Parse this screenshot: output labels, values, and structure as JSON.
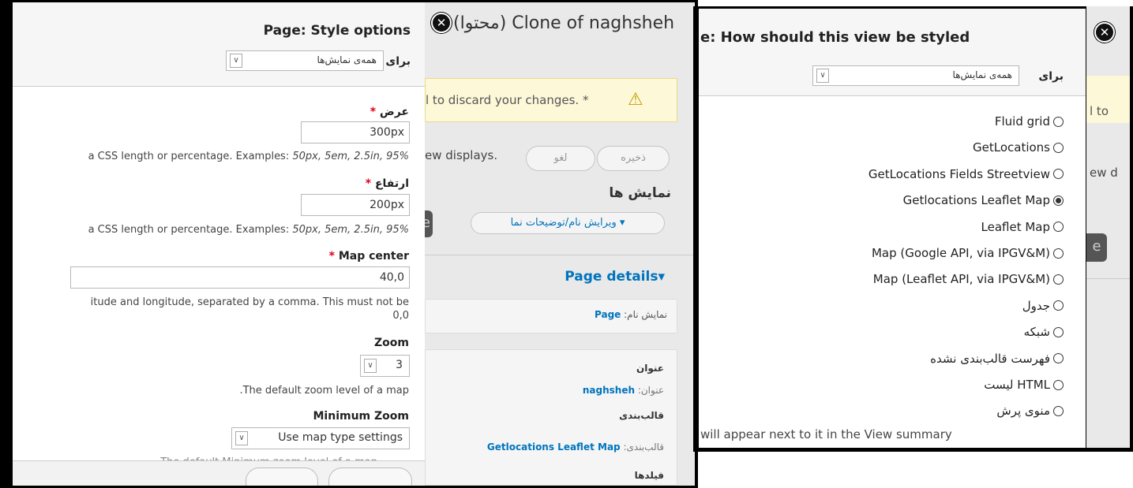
{
  "left_dialog": {
    "title": "Page: Style options",
    "for_label": "برای",
    "for_value": "همه‌ی نمایش‌ها",
    "width": {
      "label": "عرض",
      "value": "300px",
      "desc_prefix": "a CSS length or percentage. Examples: ",
      "desc_examples": "50px, 5em, 2.5in, 95%"
    },
    "height": {
      "label": "ارتفاع",
      "value": "200px",
      "desc_prefix": "a CSS length or percentage. Examples: ",
      "desc_examples": "50px, 5em, 2.5in, 95%"
    },
    "map_center": {
      "label": "Map center",
      "value": "40,0",
      "desc_line1": "itude and longitude, separated by a comma. This must not be",
      "desc_line2": "0,0"
    },
    "zoom": {
      "label": "Zoom",
      "value": "3",
      "desc": ".The default zoom level of a map"
    },
    "min_zoom": {
      "label": "Minimum Zoom",
      "value": "Use map type settings",
      "desc_partial": "The default Minimum zoom level of a map"
    },
    "required_mark": "*"
  },
  "left_background": {
    "header_title": "(محتوا) Clone of naghsheh",
    "warning_text": "l to discard your changes. *",
    "displays_text": "ew displays.",
    "save_button": "ذخیره",
    "cancel_button": "لغو",
    "displays_heading": "نمایش ها",
    "edit_name_label": "ویرایش نام/توضیحات نما",
    "page_details": "Page details",
    "display_name_label": "نمایش نام:",
    "display_name_value": "Page",
    "title_heading": "عنوان",
    "title_label": "عنوان:",
    "title_value": "naghsheh",
    "format_heading": "قالب‌بندی",
    "format_label": "قالب‌بندی:",
    "format_value": "Getlocations Leaflet Map",
    "fields_heading": "فیلدها",
    "side_button": "e"
  },
  "right_dialog": {
    "title": "e: How should this view be styled",
    "for_label": "برای",
    "for_value": "همه‌ی نمایش‌ها",
    "options": [
      {
        "label": "Fluid grid",
        "checked": false
      },
      {
        "label": "GetLocations",
        "checked": false
      },
      {
        "label": "GetLocations Fields Streetview",
        "checked": false
      },
      {
        "label": "Getlocations Leaflet Map",
        "checked": true
      },
      {
        "label": "Leaflet Map",
        "checked": false
      },
      {
        "label": "Map (Google API, via IPGV&M)",
        "checked": false
      },
      {
        "label": "Map (Leaflet API, via IPGV&M)",
        "checked": false
      },
      {
        "label": "جدول",
        "checked": false
      },
      {
        "label": "شبکه",
        "checked": false
      },
      {
        "label": "فهرست قالب‌بندی نشده",
        "checked": false
      },
      {
        "label": "لیست HTML",
        "checked": false
      },
      {
        "label": "منوی پرش",
        "checked": false
      }
    ],
    "footer_text": "will appear next to it in the View summary"
  },
  "right_background": {
    "frag1": "l to",
    "frag2": "ew d",
    "side_button": "e"
  }
}
